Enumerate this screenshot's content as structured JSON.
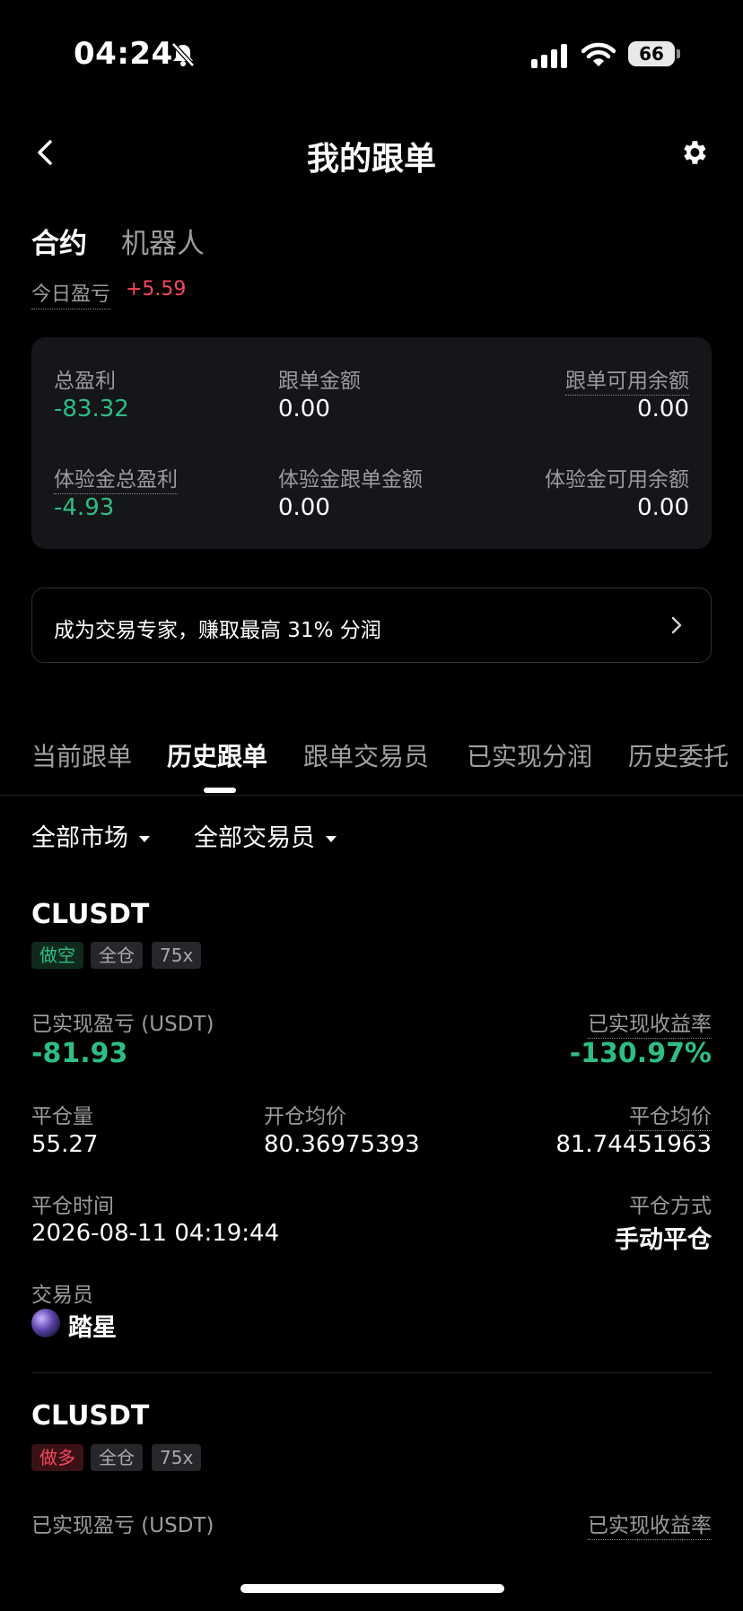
{
  "status_bar": {
    "time": "04:24",
    "battery": "66",
    "icons": [
      "bell-slash-icon",
      "signal-icon",
      "wifi-icon",
      "battery-icon"
    ]
  },
  "header": {
    "title": "我的跟单",
    "back_icon": "chevron-left-icon",
    "settings_icon": "gear-icon"
  },
  "top_tabs": [
    "合约",
    "机器人"
  ],
  "today_pnl": {
    "label": "今日盈亏",
    "value": "+5.59"
  },
  "summary": {
    "total_profit": {
      "label": "总盈利",
      "value": "-83.32"
    },
    "follow_amount": {
      "label": "跟单金额",
      "value": "0.00"
    },
    "available": {
      "label": "跟单可用余额",
      "value": "0.00"
    },
    "trial_total_profit": {
      "label": "体验金总盈利",
      "value": "-4.93"
    },
    "trial_follow_amount": {
      "label": "体验金跟单金额",
      "value": "0.00"
    },
    "trial_available": {
      "label": "体验金可用余额",
      "value": "0.00"
    }
  },
  "banner": {
    "text": "成为交易专家，赚取最高 31% 分润"
  },
  "sub_tabs": [
    "当前跟单",
    "历史跟单",
    "跟单交易员",
    "已实现分润",
    "历史委托"
  ],
  "filters": {
    "market": "全部市场",
    "trader": "全部交易员"
  },
  "colors": {
    "profit": "#f6465d",
    "loss": "#2ebd85",
    "background": "#000000",
    "card": "#15161a"
  },
  "orders": [
    {
      "symbol": "CLUSDT",
      "tags": [
        "做空",
        "全仓",
        "75x"
      ],
      "realized_pnl_label": "已实现盈亏 (USDT)",
      "realized_pnl": "-81.93",
      "realized_roi_label": "已实现收益率",
      "realized_roi": "-130.97%",
      "close_qty_label": "平仓量",
      "close_qty": "55.27",
      "open_avg_label": "开仓均价",
      "open_avg": "80.36975393",
      "close_avg_label": "平仓均价",
      "close_avg": "81.74451963",
      "close_time_label": "平仓时间",
      "close_time": "2026-08-11 04:19:44",
      "close_method_label": "平仓方式",
      "close_method": "手动平仓",
      "trader_label": "交易员",
      "trader": "踏星"
    },
    {
      "symbol": "CLUSDT",
      "tags": [
        "做多",
        "全仓",
        "75x"
      ],
      "realized_pnl_label": "已实现盈亏 (USDT)",
      "realized_roi_label": "已实现收益率"
    }
  ]
}
